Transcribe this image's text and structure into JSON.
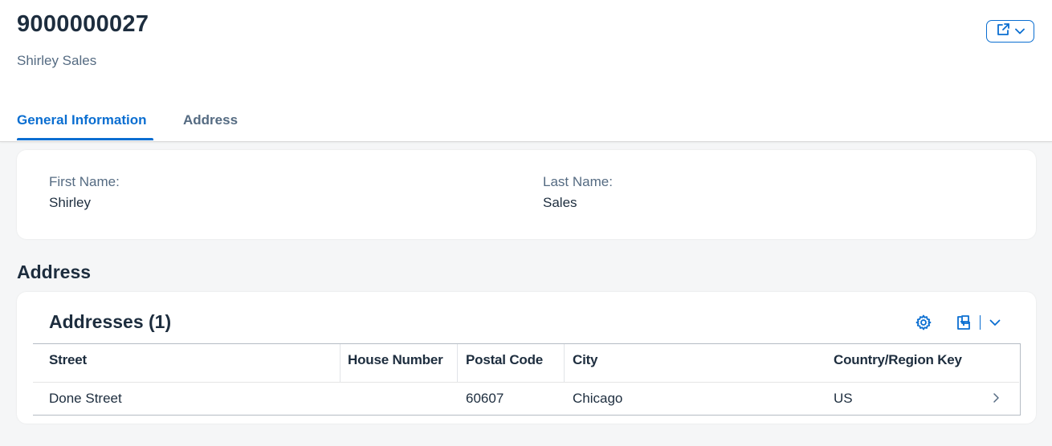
{
  "header": {
    "title": "9000000027",
    "subtitle": "Shirley Sales",
    "share_icon": "share-icon",
    "menu_icon": "chevron-down-icon"
  },
  "tabs": [
    {
      "label": "General Information",
      "selected": true
    },
    {
      "label": "Address",
      "selected": false
    }
  ],
  "general": {
    "first_name_label": "First Name:",
    "first_name_value": "Shirley",
    "last_name_label": "Last Name:",
    "last_name_value": "Sales"
  },
  "address_section": {
    "title": "Address",
    "table_title": "Addresses (1)",
    "toolbar_icons": [
      "settings-icon",
      "export-icon",
      "chevron-down-icon"
    ],
    "columns": [
      "Street",
      "House Number",
      "Postal Code",
      "City",
      "Country/Region Key"
    ],
    "rows": [
      {
        "street": "Done Street",
        "house_number": "",
        "postal_code": "60607",
        "city": "Chicago",
        "country": "US"
      }
    ]
  },
  "colors": {
    "accent": "#0a6ed1",
    "text": "#1d2d3e",
    "muted": "#556b82",
    "background": "#f5f6f7"
  }
}
